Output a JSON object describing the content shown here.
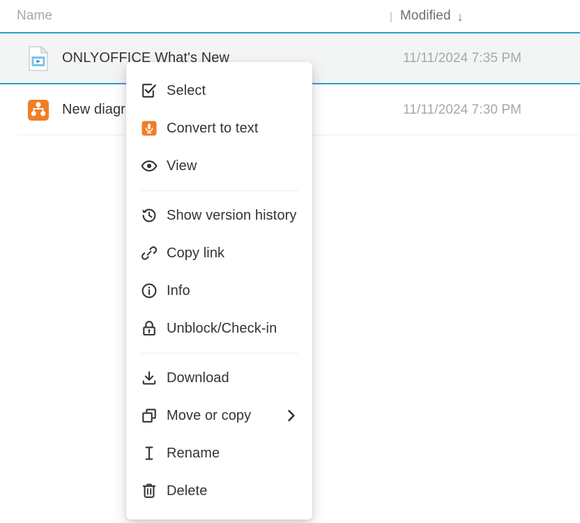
{
  "table": {
    "columns": [
      {
        "key": "name",
        "label": "Name",
        "sorted": false
      },
      {
        "key": "modified",
        "label": "Modified",
        "sorted": true,
        "sort_arrow": "↓"
      }
    ],
    "rows": [
      {
        "name": "ONLYOFFICE What's New",
        "modified": "11/11/2024 7:35 PM",
        "icon": "media-file-icon",
        "selected": true
      },
      {
        "name": "New diagram",
        "modified": "11/11/2024 7:30 PM",
        "icon": "diagram-file-icon",
        "selected": false
      }
    ]
  },
  "context_menu": {
    "items": [
      {
        "label": "Select",
        "icon": "checkbox-checked-icon",
        "submenu": false
      },
      {
        "label": "Convert to text",
        "icon": "microphone-icon",
        "submenu": false
      },
      {
        "label": "View",
        "icon": "eye-icon",
        "submenu": false
      },
      {
        "label": "Show version history",
        "icon": "history-clock-icon",
        "submenu": false
      },
      {
        "label": "Copy link",
        "icon": "link-icon",
        "submenu": false
      },
      {
        "label": "Info",
        "icon": "info-circle-icon",
        "submenu": false
      },
      {
        "label": "Unblock/Check-in",
        "icon": "lock-icon",
        "submenu": false
      },
      {
        "label": "Download",
        "icon": "download-icon",
        "submenu": false
      },
      {
        "label": "Move or copy",
        "icon": "copy-icon",
        "submenu": true,
        "chevron": "›"
      },
      {
        "label": "Rename",
        "icon": "text-cursor-icon",
        "submenu": false
      },
      {
        "label": "Delete",
        "icon": "trash-icon",
        "submenu": false
      }
    ],
    "separators_after": [
      2,
      6
    ]
  },
  "colors": {
    "accent_blue": "#2da2c9",
    "accent_orange": "#f07e26",
    "row_selected_bg": "#f3f4f4",
    "text_primary": "#333333",
    "text_muted": "#a3a9ae",
    "header_text": "#657077"
  }
}
